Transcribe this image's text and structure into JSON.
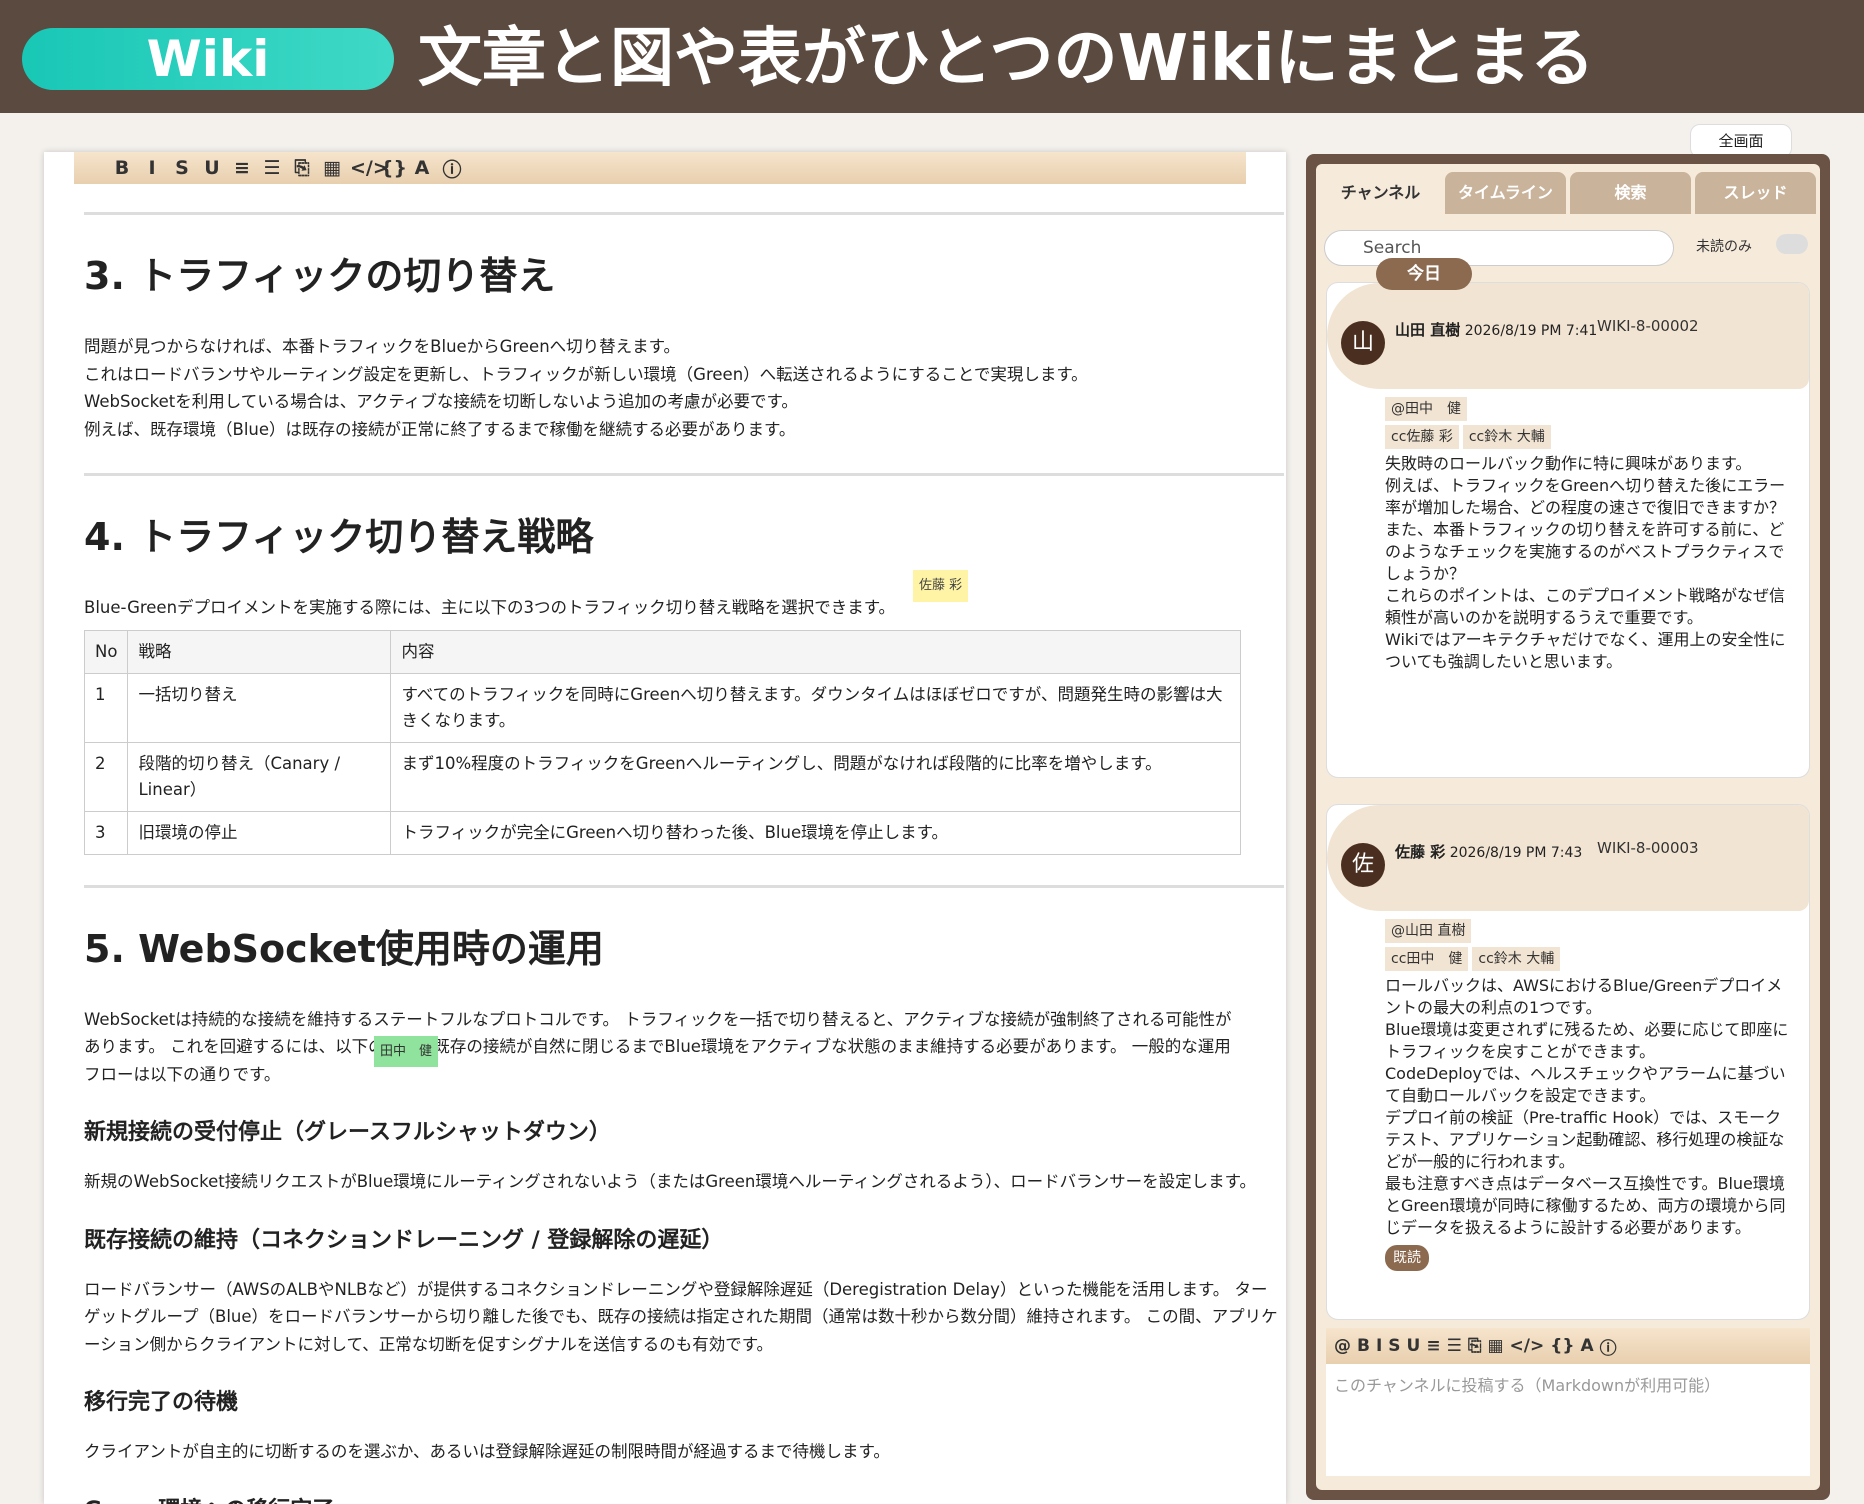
{
  "banner": {
    "pill": "Wiki",
    "title": "文章と図や表がひとつのWikiにまとまる"
  },
  "editor_toolbar": [
    "B",
    "I",
    "S",
    "U",
    "≡",
    "☰",
    "⎘",
    "▦",
    "</>",
    "{}",
    "A",
    "ⓘ"
  ],
  "doc": {
    "h3a": "3. トラフィックの切り替え",
    "p3": [
      "問題が見つからなければ、本番トラフィックをBlueからGreenへ切り替えます。",
      "これはロードバランサやルーティング設定を更新し、トラフィックが新しい環境（Green）へ転送されるようにすることで実現します。",
      "WebSocketを利用している場合は、アクティブな接続を切断しないよう追加の考慮が必要です。",
      "例えば、既存環境（Blue）は既存の接続が正常に終了するまで稼働を継続する必要があります。"
    ],
    "h4": "4. トラフィック切り替え戦略",
    "p4": "Blue-Greenデプロイメントを実施する際には、主に以下の3つのトラフィック切り替え戦略を選択できます。",
    "tag1": "佐藤 彩",
    "table": {
      "headers": [
        "No",
        "戦略",
        "内容"
      ],
      "rows": [
        [
          "1",
          "一括切り替え",
          "すべてのトラフィックを同時にGreenへ切り替えます。ダウンタイムはほぼゼロですが、問題発生時の影響は大きくなります。"
        ],
        [
          "2",
          "段階的切り替え（Canary / Linear）",
          "まず10%程度のトラフィックをGreenへルーティングし、問題がなければ段階的に比率を増やします。"
        ],
        [
          "3",
          "旧環境の停止",
          "トラフィックが完全にGreenへ切り替わった後、Blue環境を停止します。"
        ]
      ]
    },
    "h5": "5. WebSocket使用時の運用",
    "p5": "WebSocketは持続的な接続を維持するステートフルなプロトコルです。 トラフィックを一括で切り替えると、アクティブな接続が強制終了される可能性があります。 これを回避するには、以下の通り、既存の接続が自然に閉じるまでBlue環境をアクティブな状態のまま維持する必要があります。 一般的な運用フローは以下の通りです。",
    "tag2": "田中　健",
    "s1": "新規接続の受付停止（グレースフルシャットダウン）",
    "s1p": "新規のWebSocket接続リクエストがBlue環境にルーティングされないよう（またはGreen環境へルーティングされるよう）、ロードバランサーを設定します。",
    "s2": "既存接続の維持（コネクションドレーニング / 登録解除の遅延）",
    "s2p": "ロードバランサー（AWSのALBやNLBなど）が提供するコネクションドレーニングや登録解除遅延（Deregistration Delay）といった機能を活用します。 ターゲットグループ（Blue）をロードバランサーから切り離した後でも、既存の接続は指定された期間（通常は数十秒から数分間）維持されます。 この間、アプリケーション側からクライアントに対して、正常な切断を促すシグナルを送信するのも有効です。",
    "s3": "移行完了の待機",
    "s3p": "クライアントが自主的に切断するのを選ぶか、あるいは登録解除遅延の制限時間が経過するまで待機します。",
    "s4": "Green環境への移行完了"
  },
  "chat": {
    "fullscreen": "全画面",
    "tabs": [
      "チャンネル",
      "タイムライン",
      "検索",
      "スレッド"
    ],
    "search_placeholder": "Search",
    "unread_label": "未読のみ",
    "today": "今日",
    "m1": {
      "avatar": "山",
      "name": "山田 直樹",
      "time": "2026/8/19 PM 7:41",
      "id": "WIKI-8-00002",
      "mentions": [
        "@田中　健",
        "cc佐藤 彩",
        "cc鈴木 大輔"
      ],
      "lines": [
        "失敗時のロールバック動作に特に興味があります。",
        "例えば、トラフィックをGreenへ切り替えた後にエラー率が増加した場合、どの程度の速さで復旧できますか？",
        "また、本番トラフィックの切り替えを許可する前に、どのようなチェックを実施するのがベストプラクティスでしょうか？",
        "これらのポイントは、このデプロイメント戦略がなぜ信頼性が高いのかを説明するうえで重要です。",
        "Wikiではアーキテクチャだけでなく、運用上の安全性についても強調したいと思います。"
      ]
    },
    "m2": {
      "avatar": "佐",
      "name": "佐藤 彩",
      "time": "2026/8/19 PM 7:43",
      "id": "WIKI-8-00003",
      "mentions": [
        "@山田 直樹",
        "cc田中　健",
        "cc鈴木 大輔"
      ],
      "lines": [
        "ロールバックは、AWSにおけるBlue/Greenデプロイメントの最大の利点の1つです。",
        "Blue環境は変更されずに残るため、必要に応じて即座にトラフィックを戻すことができます。",
        "CodeDeployでは、ヘルスチェックやアラームに基づいて自動ロールバックを設定できます。",
        "デプロイ前の検証（Pre-traffic Hook）では、スモークテスト、アプリケーション起動確認、移行処理の検証などが一般的に行われます。",
        "最も注意すべき点はデータベース互換性です。Blue環境とGreen環境が同時に稼働するため、両方の環境から同じデータを扱えるように設計する必要があります。"
      ],
      "read": "既読"
    },
    "compose_placeholder": "このチャンネルに投稿する（Markdownが利用可能）"
  }
}
